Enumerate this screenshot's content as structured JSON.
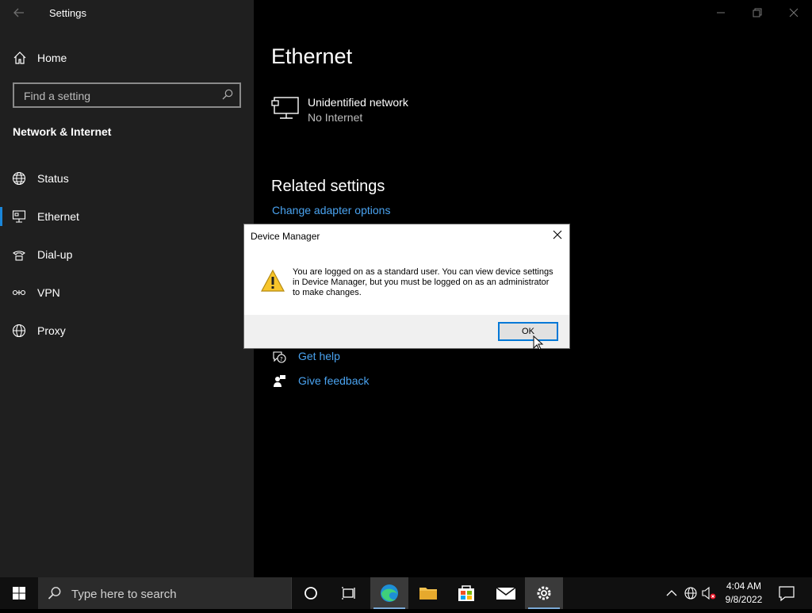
{
  "window": {
    "title": "Settings"
  },
  "sidebar": {
    "home_label": "Home",
    "search_placeholder": "Find a setting",
    "section_title": "Network & Internet",
    "items": [
      {
        "label": "Status",
        "icon": "globe-icon"
      },
      {
        "label": "Ethernet",
        "icon": "ethernet-icon",
        "active": true
      },
      {
        "label": "Dial-up",
        "icon": "dialup-icon"
      },
      {
        "label": "VPN",
        "icon": "vpn-icon"
      },
      {
        "label": "Proxy",
        "icon": "globe-icon"
      }
    ]
  },
  "main": {
    "title": "Ethernet",
    "network": {
      "name": "Unidentified network",
      "status": "No Internet"
    },
    "related_title": "Related settings",
    "adapter_link": "Change adapter options",
    "help_links": [
      {
        "label": "Get help",
        "icon": "help-icon"
      },
      {
        "label": "Give feedback",
        "icon": "feedback-icon"
      }
    ]
  },
  "dialog": {
    "title": "Device Manager",
    "message": "You are logged on as a standard user. You can view device settings in Device Manager, but you must be logged on as an administrator to make changes.",
    "ok_label": "OK",
    "icon": "warning-icon"
  },
  "taskbar": {
    "search_placeholder": "Type here to search",
    "time": "4:04 AM",
    "date": "9/8/2022"
  },
  "colors": {
    "accent": "#1a86d9",
    "link": "#4aa3f0",
    "sidebar": "#1f1f1f",
    "content": "#000000"
  }
}
